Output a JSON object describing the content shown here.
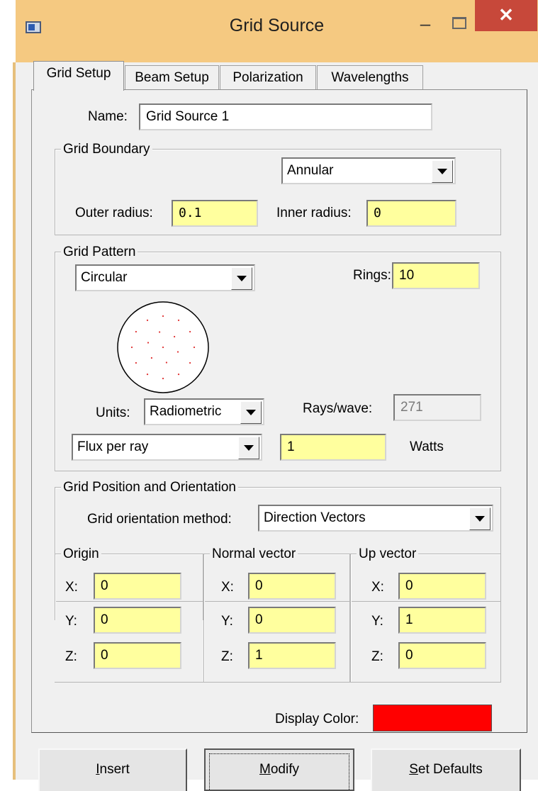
{
  "window": {
    "title": "Grid Source",
    "minimize_glyph": "–",
    "close_glyph": "✕"
  },
  "tabs": [
    {
      "label": "Grid Setup",
      "active": true
    },
    {
      "label": "Beam Setup",
      "active": false
    },
    {
      "label": "Polarization",
      "active": false
    },
    {
      "label": "Wavelengths",
      "active": false
    }
  ],
  "name": {
    "label": "Name:",
    "value": "Grid Source 1"
  },
  "grid_boundary": {
    "title": "Grid Boundary",
    "shape": "Annular",
    "outer_radius_label": "Outer radius:",
    "outer_radius": "0.1",
    "inner_radius_label": "Inner radius:",
    "inner_radius": "0"
  },
  "grid_pattern": {
    "title": "Grid Pattern",
    "pattern": "Circular",
    "rings_label": "Rings:",
    "rings": "10",
    "units_label": "Units:",
    "units": "Radiometric",
    "rays_per_wave_label": "Rays/wave:",
    "rays_per_wave": "271",
    "flux_mode": "Flux per ray",
    "flux_value": "1",
    "flux_unit": "Watts",
    "preview_dot_color": "#e03030"
  },
  "grid_position": {
    "title": "Grid Position and Orientation",
    "method_label": "Grid orientation method:",
    "method": "Direction Vectors",
    "origin": {
      "title": "Origin",
      "x_label": "X:",
      "x": "0",
      "y_label": "Y:",
      "y": "0",
      "z_label": "Z:",
      "z": "0"
    },
    "normal": {
      "title": "Normal vector",
      "x_label": "X:",
      "x": "0",
      "y_label": "Y:",
      "y": "0",
      "z_label": "Z:",
      "z": "1"
    },
    "up": {
      "title": "Up vector",
      "x_label": "X:",
      "x": "0",
      "y_label": "Y:",
      "y": "1",
      "z_label": "Z:",
      "z": "0"
    }
  },
  "display_color": {
    "label": "Display Color:",
    "color": "#ff0000"
  },
  "buttons": {
    "insert_first": "I",
    "insert_rest": "nsert",
    "modify_first": "M",
    "modify_rest": "odify",
    "set_defaults_first": "S",
    "set_defaults_rest": "et Defaults"
  }
}
